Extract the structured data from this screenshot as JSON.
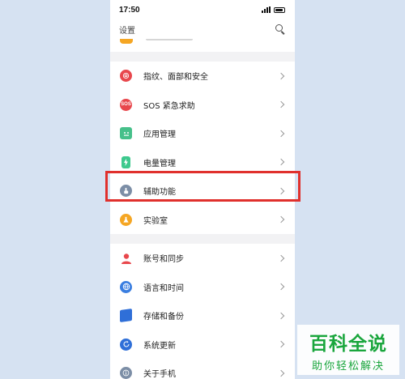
{
  "status_bar": {
    "time": "17:50"
  },
  "header": {
    "title": "设置"
  },
  "groups": [
    {
      "items": [
        {
          "label": "指纹、面部和安全",
          "icon": "fingerprint-icon",
          "color": "#e8474c"
        },
        {
          "label": "SOS 紧急求助",
          "icon": "sos-icon",
          "color": "#e8474c",
          "icon_text": "SOS"
        },
        {
          "label": "应用管理",
          "icon": "app-icon",
          "color": "#46c08a"
        },
        {
          "label": "电量管理",
          "icon": "battery-icon",
          "color": "#3ec98e"
        },
        {
          "label": "辅助功能",
          "icon": "accessibility-icon",
          "color": "#7c8ea6"
        },
        {
          "label": "实验室",
          "icon": "lab-icon",
          "color": "#f5a623"
        }
      ]
    },
    {
      "items": [
        {
          "label": "账号和同步",
          "icon": "account-icon",
          "color": "#e8474c"
        },
        {
          "label": "语言和时间",
          "icon": "globe-icon",
          "color": "#3a7ee0"
        },
        {
          "label": "存储和备份",
          "icon": "storage-icon",
          "color": "#2f6fd8"
        },
        {
          "label": "系统更新",
          "icon": "update-icon",
          "color": "#2f6fd8"
        },
        {
          "label": "关于手机",
          "icon": "info-icon",
          "color": "#7c8ea6"
        }
      ]
    }
  ],
  "watermark": {
    "title": "百科全说",
    "subtitle": "助你轻松解决"
  },
  "highlight_color": "#e0302d"
}
